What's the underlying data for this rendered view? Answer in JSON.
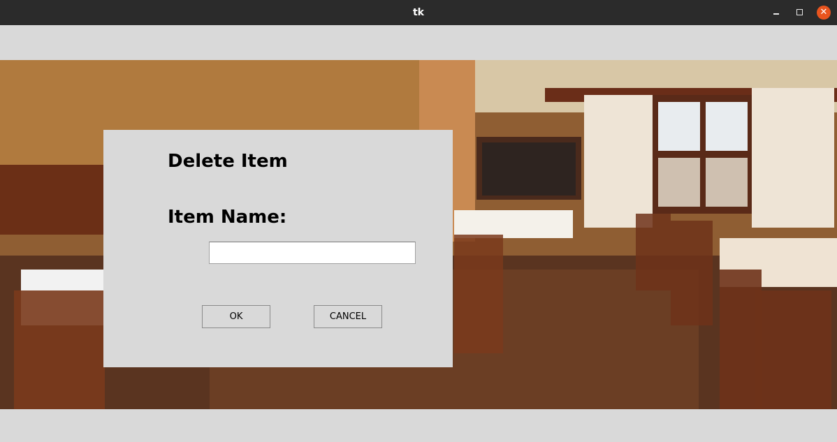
{
  "window": {
    "title": "tk",
    "controls": {
      "minimize": "minimize-icon",
      "maximize": "maximize-icon",
      "close": "close-icon"
    },
    "close_color": "#e9541e"
  },
  "background": {
    "image": "restaurant-interior-photo"
  },
  "dialog": {
    "heading": "Delete Item",
    "field_label": "Item Name:",
    "item_name_value": "",
    "ok_label": "OK",
    "cancel_label": "CANCEL"
  }
}
